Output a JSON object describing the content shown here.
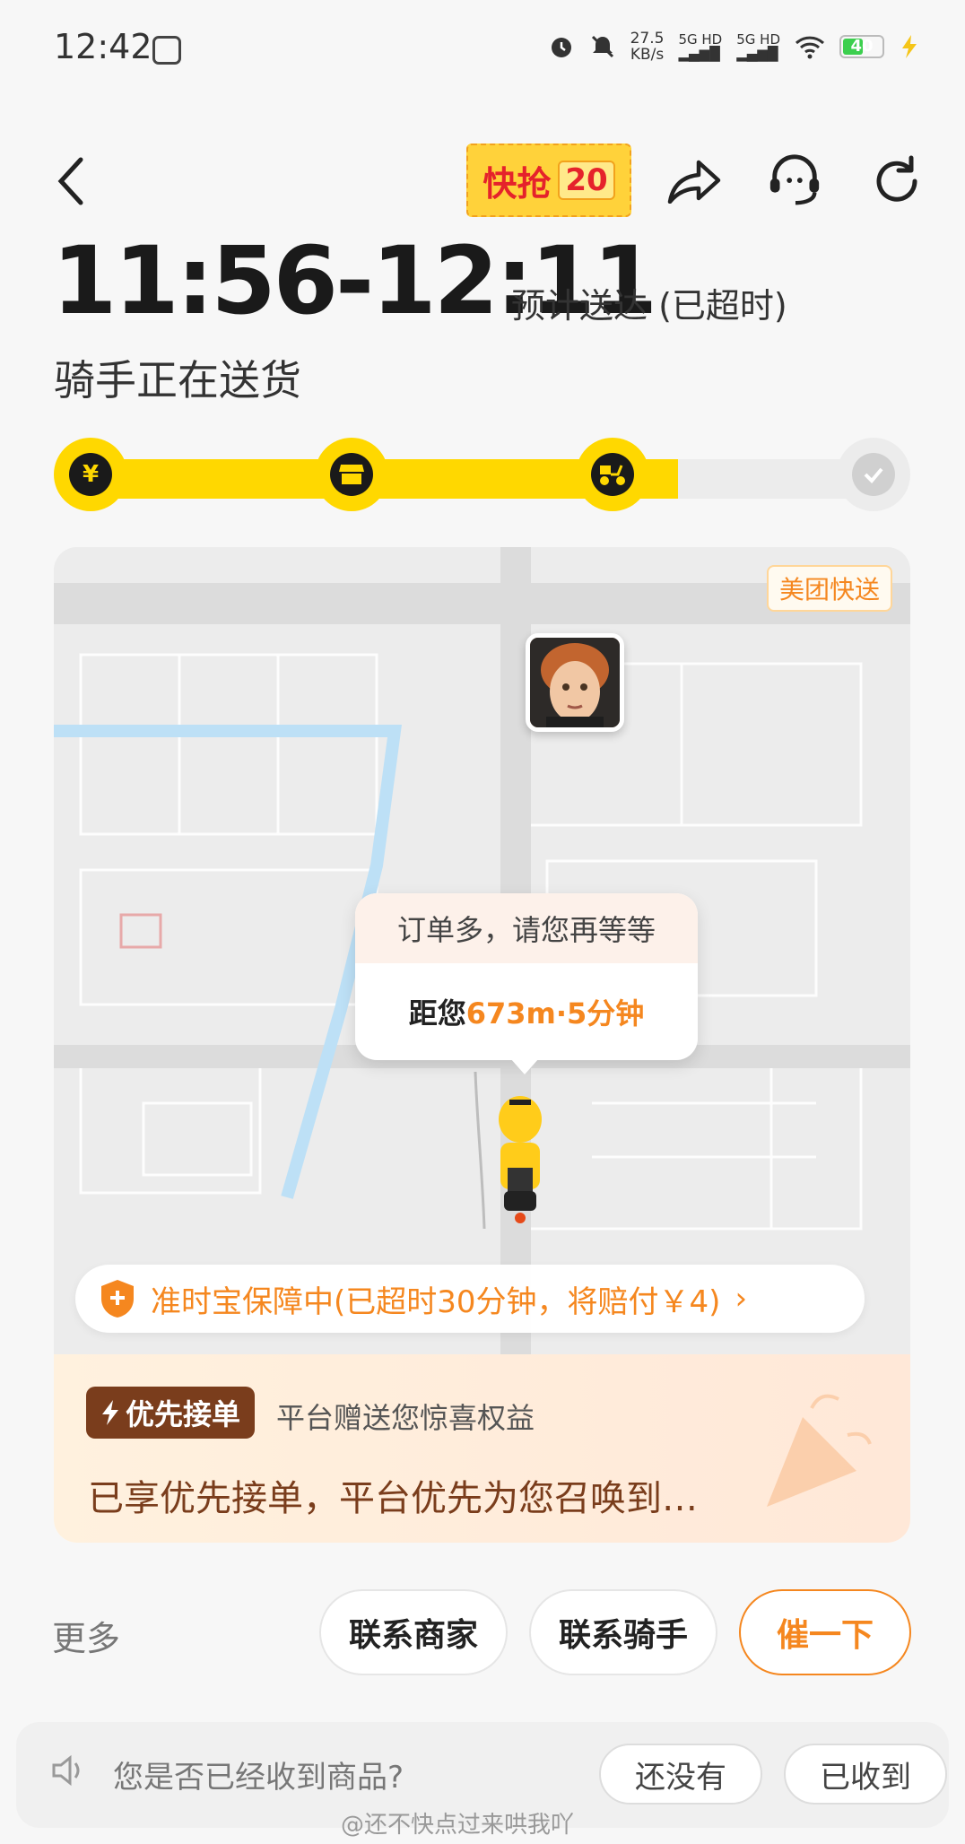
{
  "status_bar": {
    "time": "12:42",
    "net_speed_value": "27.5",
    "net_speed_unit": "KB/s",
    "sim1": "5G HD",
    "sim2": "5G HD",
    "battery": "40"
  },
  "header": {
    "promo_label": "快抢",
    "promo_number": "20",
    "icons": [
      "back-arrow-icon",
      "share-icon",
      "customer-service-icon",
      "refresh-icon"
    ]
  },
  "eta": {
    "time_range": "11:56-12:11",
    "label": "预计送达 (已超时)",
    "status": "骑手正在送货"
  },
  "progress": {
    "steps": [
      {
        "icon": "yuan-icon",
        "state": "done"
      },
      {
        "icon": "store-icon",
        "state": "done"
      },
      {
        "icon": "scooter-icon",
        "state": "current"
      },
      {
        "icon": "check-icon",
        "state": "pending"
      }
    ],
    "fill_fraction": 0.75
  },
  "map": {
    "brand_tag": "美团快送",
    "bubble_top": "订单多，请您再等等",
    "bubble_distance_prefix": "距您",
    "bubble_distance": "673m·5分钟"
  },
  "guarantee": {
    "text": "准时宝保障中(已超时30分钟，将赔付￥4)",
    "chevron": "›"
  },
  "priority": {
    "badge": "优先接单",
    "subtitle": "平台赠送您惊喜权益",
    "main": "已享优先接单，平台优先为您召唤到…"
  },
  "actions": {
    "more": "更多",
    "contact_merchant": "联系商家",
    "contact_rider": "联系骑手",
    "urge": "催一下"
  },
  "confirm": {
    "question": "您是否已经收到商品?",
    "not_yet": "还没有",
    "received": "已收到"
  },
  "watermark": "@还不快点过来哄我吖",
  "colors": {
    "accent_yellow": "#ffd800",
    "accent_orange": "#f5871f",
    "brown": "#7a3d1c"
  }
}
